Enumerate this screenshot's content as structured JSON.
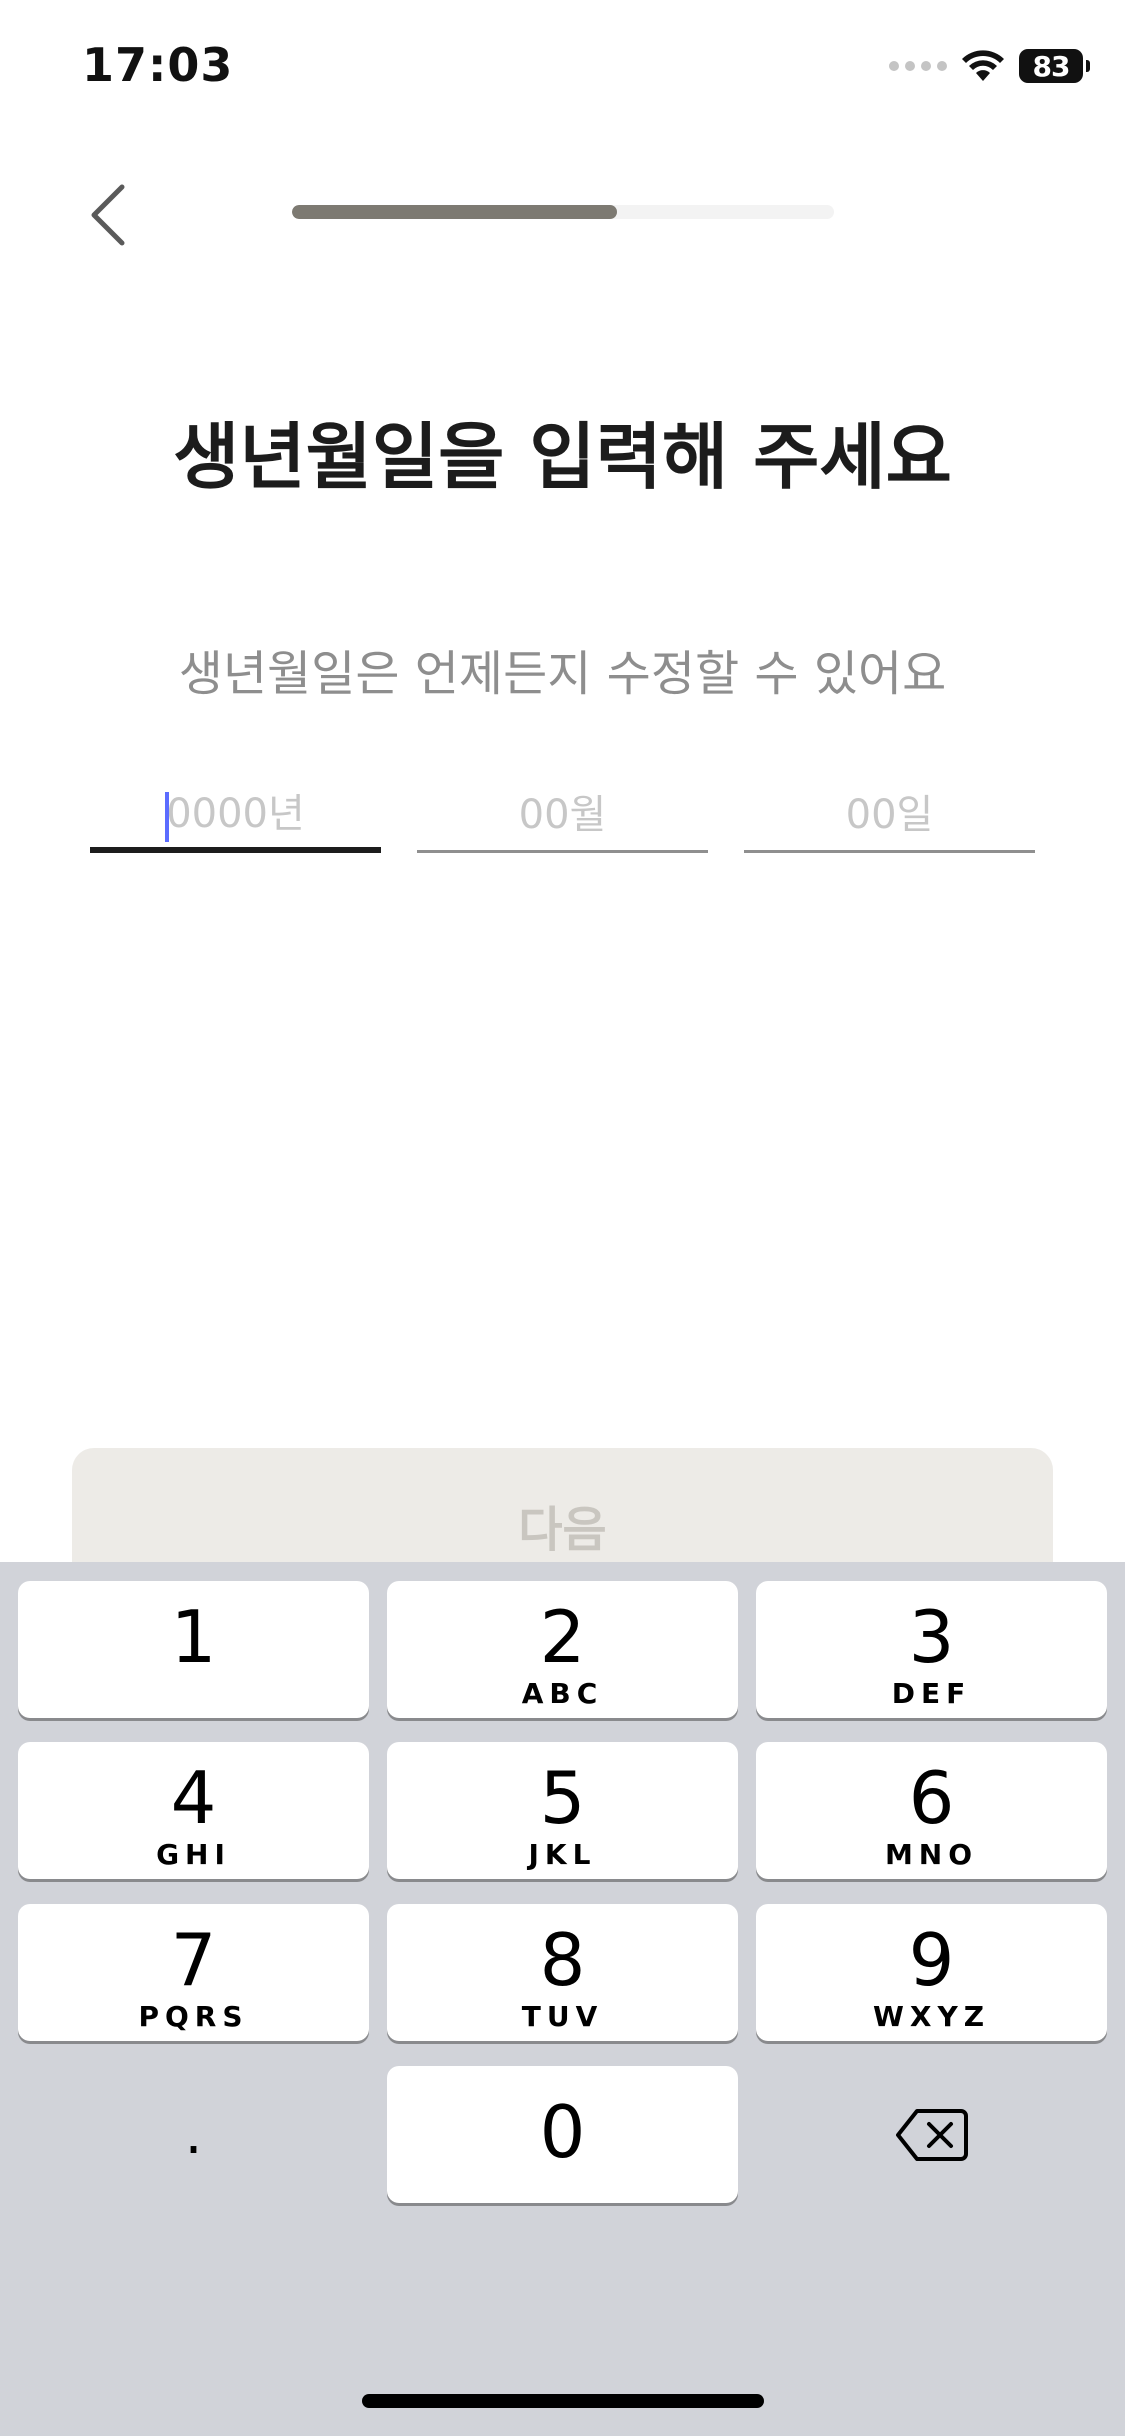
{
  "status_bar": {
    "time": "17:03",
    "battery": "83",
    "signal_icon": "cellular-signal-icon",
    "wifi_icon": "wifi-icon"
  },
  "header": {
    "back_icon": "chevron-left-icon",
    "progress": 0.6
  },
  "title": "생년월일을 입력해 주세요",
  "subtitle": "생년월일은 언제든지 수정할 수 있어요",
  "fields": {
    "year": {
      "value": "",
      "placeholder": "0000년"
    },
    "month": {
      "value": "",
      "placeholder": "00월"
    },
    "day": {
      "value": "",
      "placeholder": "00일"
    }
  },
  "next_button": {
    "label": "다음"
  },
  "keypad": {
    "keys": [
      {
        "digit": "1",
        "letters": ""
      },
      {
        "digit": "2",
        "letters": "ABC"
      },
      {
        "digit": "3",
        "letters": "DEF"
      },
      {
        "digit": "4",
        "letters": "GHI"
      },
      {
        "digit": "5",
        "letters": "JKL"
      },
      {
        "digit": "6",
        "letters": "MNO"
      },
      {
        "digit": "7",
        "letters": "PQRS"
      },
      {
        "digit": "8",
        "letters": "TUV"
      },
      {
        "digit": "9",
        "letters": "WXYZ"
      }
    ],
    "dot_key": ".",
    "zero_key": "0",
    "delete_icon": "backspace-icon"
  },
  "colors": {
    "progress_fill": "#7d7a72",
    "progress_track": "#f3f3f3",
    "button_bg": "#edebe7",
    "button_text": "#c9c6c0",
    "keyboard_bg": "#d1d3d9",
    "caret": "#5b6cff"
  }
}
